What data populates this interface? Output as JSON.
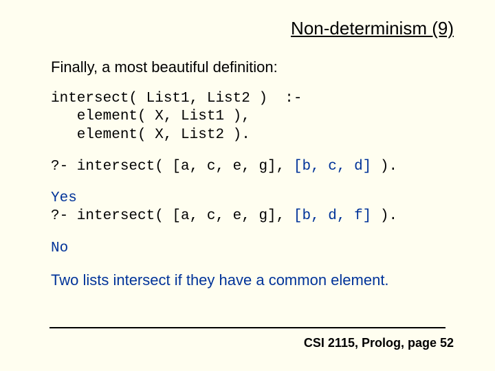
{
  "title": "Non-determinism (9)",
  "intro": "Finally, a most beautiful definition:",
  "code": {
    "defn": "intersect( List1, List2 )  :-\n   element( X, List1 ),\n   element( X, List2 ).",
    "q1_prefix": "?- intersect( [a, c, e, g], ",
    "q1_arg2": "[b, c, d]",
    "q1_suffix": " ).",
    "r1": "Yes",
    "q2_prefix": "?- intersect( [a, c, e, g], ",
    "q2_arg2": "[b, d, f]",
    "q2_suffix": " ).",
    "r2": "No"
  },
  "conclusion": "Two lists intersect if they have a common element.",
  "footer": "CSI 2115, Prolog, page 52"
}
